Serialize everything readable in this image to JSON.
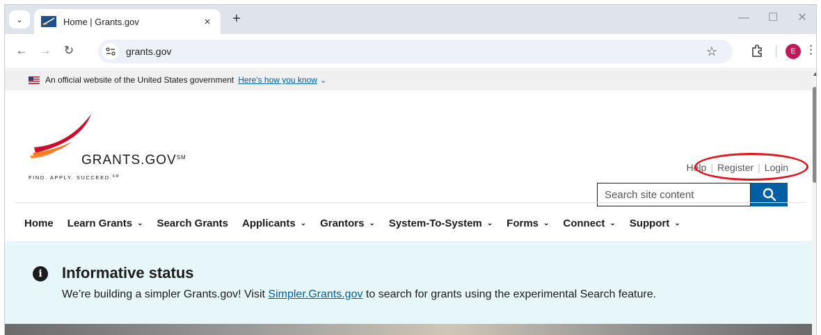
{
  "browser": {
    "tab_title": "Home | Grants.gov",
    "tab_close": "×",
    "new_tab": "+",
    "url": "grants.gov",
    "profile_initial": "E",
    "window_controls": {
      "minimize": "—",
      "maximize": "☐",
      "close": "✕"
    }
  },
  "gov_banner": {
    "text": "An official website of the United States government",
    "link": "Here's how you know"
  },
  "header": {
    "brand": "GRANTS.GOV",
    "brand_mark": "SM",
    "tagline": "FIND. APPLY. SUCCEED.",
    "tagline_mark": "SM",
    "util_links": {
      "help": "Help",
      "register": "Register",
      "login": "Login"
    },
    "search": {
      "placeholder": "Search site content"
    }
  },
  "main_nav": [
    {
      "label": "Home",
      "dropdown": false
    },
    {
      "label": "Learn Grants",
      "dropdown": true
    },
    {
      "label": "Search Grants",
      "dropdown": false
    },
    {
      "label": "Applicants",
      "dropdown": true
    },
    {
      "label": "Grantors",
      "dropdown": true
    },
    {
      "label": "System-To-System",
      "dropdown": true
    },
    {
      "label": "Forms",
      "dropdown": true
    },
    {
      "label": "Connect",
      "dropdown": true
    },
    {
      "label": "Support",
      "dropdown": true
    }
  ],
  "alert": {
    "title": "Informative status",
    "body_prefix": "We’re building a simpler Grants.gov! Visit ",
    "body_link": "Simpler.Grants.gov",
    "body_suffix": " to search for grants using the experimental Search feature."
  },
  "colors": {
    "link_blue": "#005ea2",
    "alert_bg": "#e7f6f8",
    "annotation_red": "#e3131b",
    "logo_red": "#c8102e",
    "logo_orange": "#f47c20"
  },
  "icons": [
    "tab-search-icon",
    "grants-favicon-icon",
    "back-arrow-icon",
    "forward-arrow-icon",
    "reload-icon",
    "site-info-icon",
    "bookmark-star-icon",
    "extensions-icon",
    "menu-kebab-icon",
    "us-flag-icon",
    "search-icon",
    "info-circle-icon"
  ]
}
